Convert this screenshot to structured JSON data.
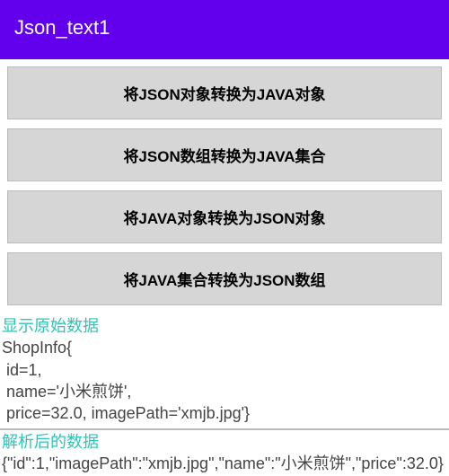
{
  "header": {
    "title": "Json_text1"
  },
  "buttons": {
    "btn1": "将JSON对象转换为JAVA对象",
    "btn2": "将JSON数组转换为JAVA集合",
    "btn3": "将JAVA对象转换为JSON对象",
    "btn4": "将JAVA集合转换为JSON数组"
  },
  "labels": {
    "original": "显示原始数据",
    "parsed": "解析后的数据"
  },
  "original_data": "ShopInfo{\n id=1,\n name='小米煎饼',\n price=32.0, imagePath='xmjb.jpg'}",
  "parsed_data": "{\"id\":1,\"imagePath\":\"xmjb.jpg\",\"name\":\"小米煎饼\",\"price\":32.0}"
}
